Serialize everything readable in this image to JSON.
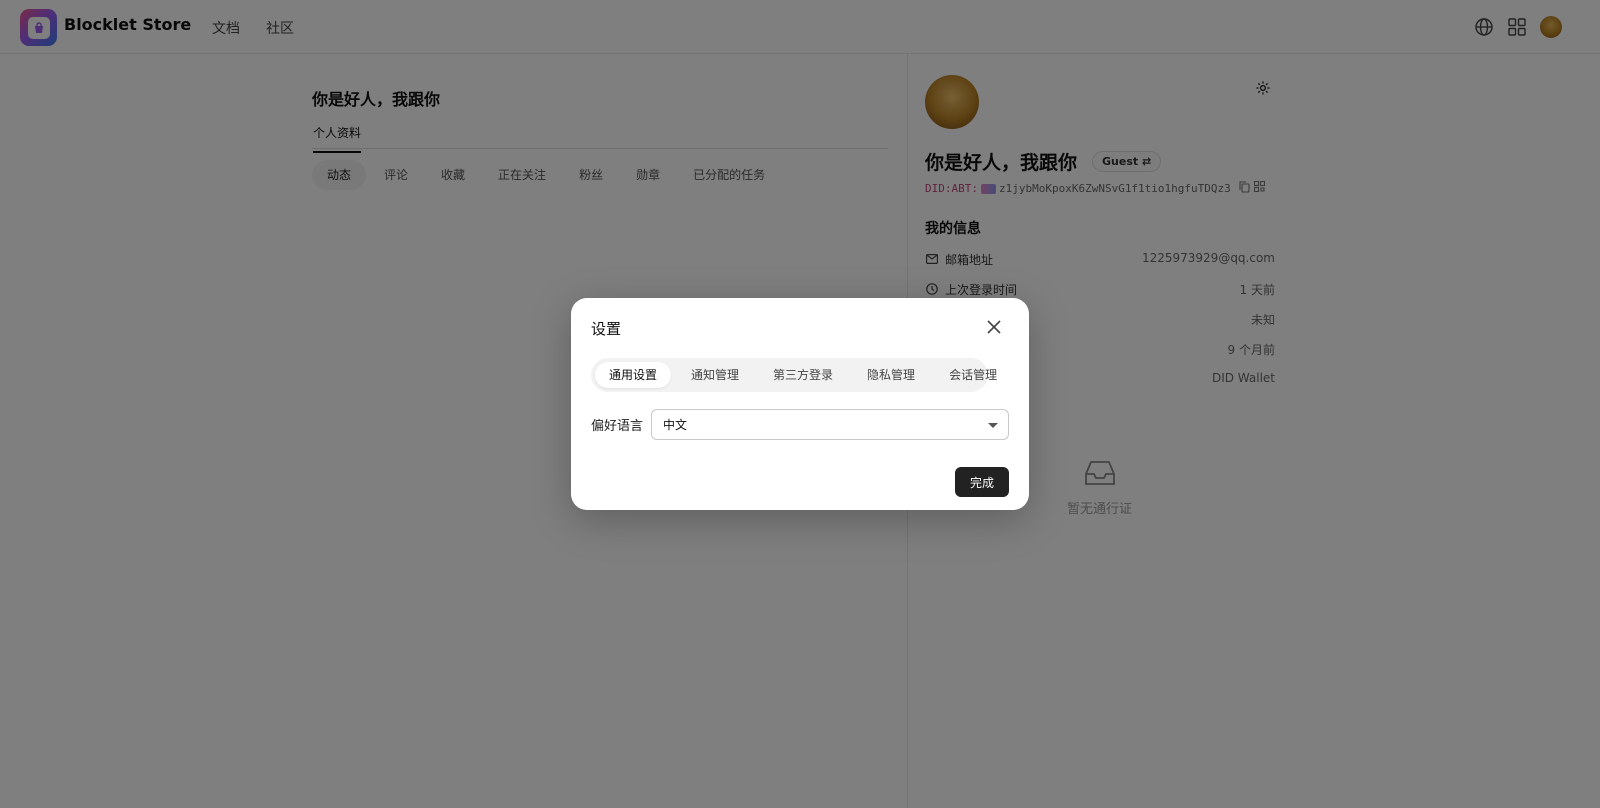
{
  "header": {
    "brand": "Blocklet Store",
    "nav": [
      "文档",
      "社区"
    ]
  },
  "left": {
    "title": "你是好人，我跟你",
    "tab": "个人资料",
    "subtabs": [
      "动态",
      "评论",
      "收藏",
      "正在关注",
      "粉丝",
      "勋章",
      "已分配的任务"
    ]
  },
  "profile": {
    "name": "你是好人，我跟你",
    "badge": "Guest ⇄",
    "did_prefix": "DID:ABT:",
    "did": "z1jybMoKpoxK6ZwNSvG1f1tio1hgfuTDQz3",
    "info_title": "我的信息",
    "info_rows": [
      {
        "label": "邮箱地址",
        "value": "1225973929@qq.com",
        "icon": "mail-icon"
      },
      {
        "label": "上次登录时间",
        "value": "1 天前",
        "icon": "clock-icon"
      },
      {
        "label": "",
        "value": "未知",
        "icon": ""
      },
      {
        "label": "",
        "value": "9 个月前",
        "icon": ""
      },
      {
        "label": "",
        "value": "DID Wallet",
        "icon": ""
      }
    ],
    "empty_text": "暂无通行证"
  },
  "modal": {
    "title": "设置",
    "tabs": [
      "通用设置",
      "通知管理",
      "第三方登录",
      "隐私管理",
      "会话管理"
    ],
    "active_tab": "通用设置",
    "language_label": "偏好语言",
    "language_value": "中文",
    "done_label": "完成"
  }
}
